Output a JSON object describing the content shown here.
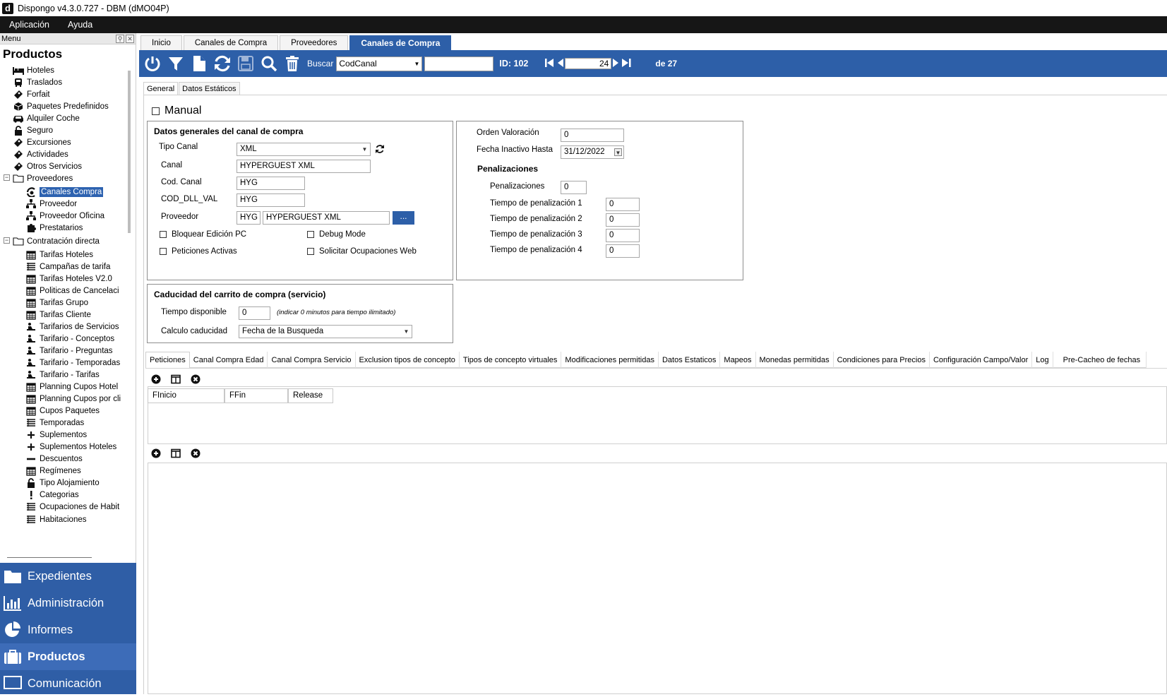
{
  "window": {
    "title": "Dispongo v4.3.0.727 - DBM (dMO04P)",
    "logo_letter": "d"
  },
  "menubar": {
    "items": [
      "Aplicación",
      "Ayuda"
    ]
  },
  "leftpanel": {
    "header_label": "Menu",
    "section_title": "Productos",
    "tree": [
      {
        "label": "Hoteles",
        "icon": "bed-icon"
      },
      {
        "label": "Traslados",
        "icon": "bus-icon"
      },
      {
        "label": "Forfait",
        "icon": "ticket-icon"
      },
      {
        "label": "Paquetes Predefinidos",
        "icon": "cube-icon"
      },
      {
        "label": "Alquiler Coche",
        "icon": "car-icon"
      },
      {
        "label": "Seguro",
        "icon": "lock-icon"
      },
      {
        "label": "Excursiones",
        "icon": "ticket-icon"
      },
      {
        "label": "Actividades",
        "icon": "ticket-icon"
      },
      {
        "label": "Otros Servicios",
        "icon": "ticket-icon"
      },
      {
        "label": "Proveedores",
        "icon": "folder-icon"
      },
      {
        "label": "Canales Compra",
        "icon": "channel-icon"
      },
      {
        "label": "Proveedor",
        "icon": "sitemap-icon"
      },
      {
        "label": "Proveedor Oficina",
        "icon": "sitemap-icon"
      },
      {
        "label": "Prestatarios",
        "icon": "puzzle-icon"
      },
      {
        "label": "Contratación directa",
        "icon": "folder-icon"
      },
      {
        "label": "Tarifas Hoteles",
        "icon": "calendar-icon"
      },
      {
        "label": "Campañas de tarifa",
        "icon": "list-icon"
      },
      {
        "label": "Tarifas Hoteles V2.0",
        "icon": "calendar-icon"
      },
      {
        "label": "Politicas de Cancelaci",
        "icon": "calendar-icon"
      },
      {
        "label": "Tarifas Grupo",
        "icon": "calendar-icon"
      },
      {
        "label": "Tarifas Cliente",
        "icon": "calendar-icon"
      },
      {
        "label": "Tarifarios de Servicios",
        "icon": "person-icon"
      },
      {
        "label": "Tarifario - Conceptos",
        "icon": "person-icon"
      },
      {
        "label": "Tarifario - Preguntas",
        "icon": "person-icon"
      },
      {
        "label": "Tarifario - Temporadas",
        "icon": "person-icon"
      },
      {
        "label": "Tarifario - Tarifas",
        "icon": "person-icon"
      },
      {
        "label": "Planning Cupos Hotel",
        "icon": "calendar-icon"
      },
      {
        "label": "Planning Cupos por cli",
        "icon": "calendar-icon"
      },
      {
        "label": "Cupos Paquetes",
        "icon": "calendar-icon"
      },
      {
        "label": "Temporadas",
        "icon": "list-icon"
      },
      {
        "label": "Suplementos",
        "icon": "plus-icon"
      },
      {
        "label": "Suplementos Hoteles",
        "icon": "plus-icon"
      },
      {
        "label": "Descuentos",
        "icon": "minus-icon"
      },
      {
        "label": "Regímenes",
        "icon": "calendar-icon"
      },
      {
        "label": "Tipo Alojamiento",
        "icon": "lock-icon"
      },
      {
        "label": "Categorias",
        "icon": "exclamation-icon"
      },
      {
        "label": "Ocupaciones de Habit",
        "icon": "list-icon"
      },
      {
        "label": "Habitaciones",
        "icon": "list-icon"
      }
    ],
    "nav": [
      {
        "label": "Expedientes",
        "icon": "folder-icon"
      },
      {
        "label": "Administración",
        "icon": "bar-chart-icon"
      },
      {
        "label": "Informes",
        "icon": "pie-chart-icon"
      },
      {
        "label": "Productos",
        "icon": "briefcase-icon",
        "active": true
      },
      {
        "label": "Comunicación",
        "icon": "monitor-icon"
      }
    ]
  },
  "doctabs": [
    "Inicio",
    "Canales de Compra",
    "Proveedores",
    "Canales de Compra"
  ],
  "toolbar": {
    "search_label": "Buscar",
    "search_field": "CodCanal",
    "search_value": "",
    "id_label": "ID: 102",
    "record_current": "24",
    "record_total_label": "de 27"
  },
  "subtabs": [
    "General",
    "Datos Estáticos"
  ],
  "form": {
    "manual_label": "Manual",
    "general": {
      "title": "Datos generales del canal de compra",
      "tipo_canal_label": "Tipo Canal",
      "tipo_canal_value": "XML",
      "canal_label": "Canal",
      "canal_value": "HYPERGUEST XML",
      "cod_canal_label": "Cod. Canal",
      "cod_canal_value": "HYG",
      "cod_dll_label": "COD_DLL_VAL",
      "cod_dll_value": "HYG",
      "proveedor_label": "Proveedor",
      "proveedor_code": "HYG",
      "proveedor_name": "HYPERGUEST XML",
      "browse_label": "...",
      "bloquear_label": "Bloquear Edición PC",
      "debug_label": "Debug Mode",
      "peticiones_label": "Peticiones Activas",
      "solicitar_label": "Solicitar Ocupaciones Web"
    },
    "valoracion": {
      "orden_label": "Orden Valoración",
      "orden_value": "0",
      "fecha_label": "Fecha Inactivo Hasta",
      "fecha_value": "31/12/2022",
      "penal_title": "Penalizaciones",
      "penal_label": "Penalizaciones",
      "penal_value": "0",
      "tiempos": [
        {
          "label": "Tiempo de penalización 1",
          "value": "0"
        },
        {
          "label": "Tiempo de penalización 2",
          "value": "0"
        },
        {
          "label": "Tiempo de penalización 3",
          "value": "0"
        },
        {
          "label": "Tiempo de penalización 4",
          "value": "0"
        }
      ]
    },
    "caducidad": {
      "title": "Caducidad del carrito de compra (servicio)",
      "tiempo_label": "Tiempo disponible",
      "tiempo_value": "0",
      "tiempo_hint": "(indicar 0 minutos para tiempo ilimitado)",
      "calculo_label": "Calculo caducidad",
      "calculo_value": "Fecha de la Busqueda"
    }
  },
  "bottomtabs": [
    "Peticiones",
    "Canal Compra Edad",
    "Canal Compra Servicio",
    "Exclusion tipos de concepto",
    "Tipos de concepto virtuales",
    "Modificaciones permitidas",
    "Datos Estaticos",
    "Mapeos",
    "Monedas permitidas",
    "Condiciones para Precios",
    "Configuración Campo/Valor",
    "Log",
    "Pre-Cacheo de fechas"
  ],
  "grid": {
    "columns": [
      "FInicio",
      "FFin",
      "Release"
    ]
  }
}
